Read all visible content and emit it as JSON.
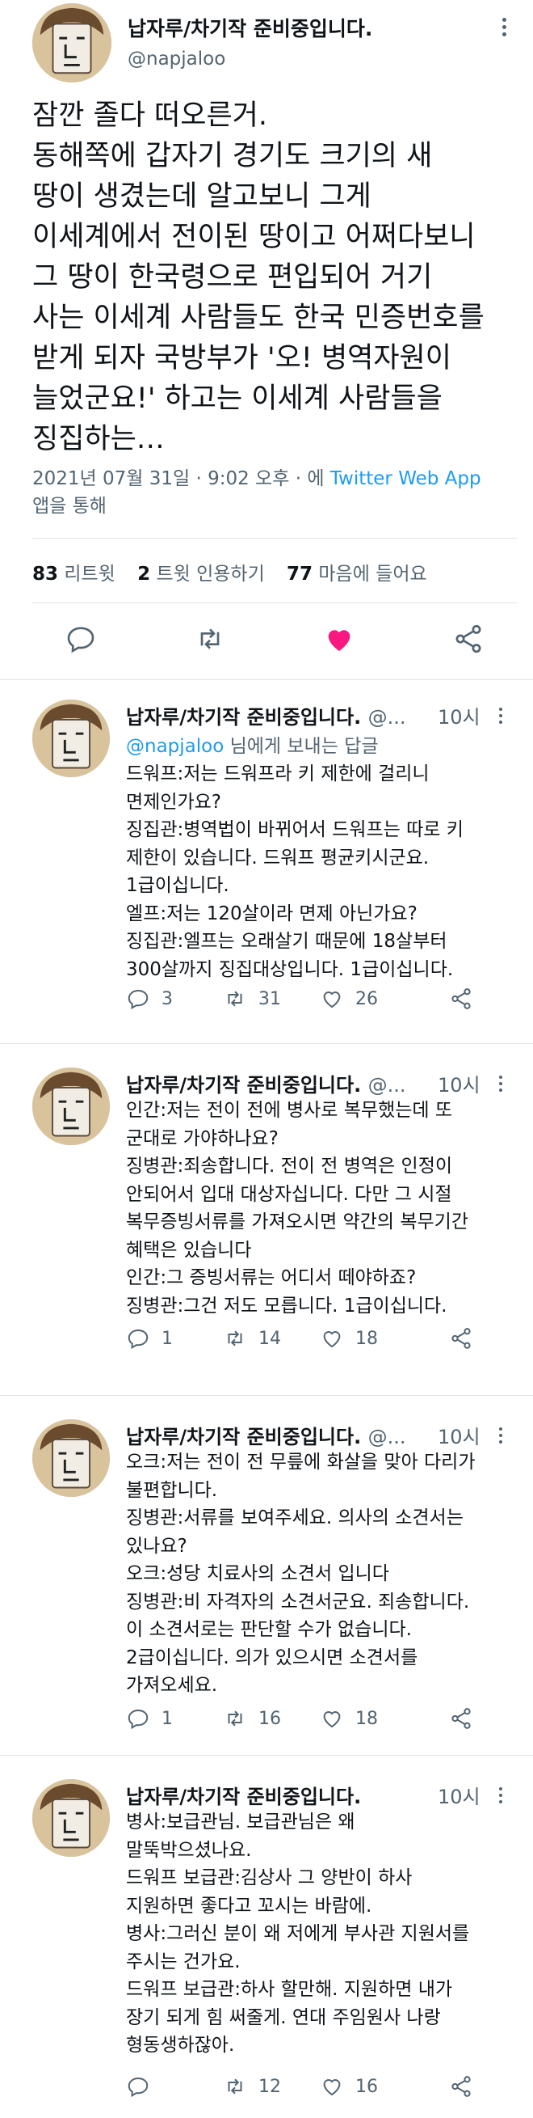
{
  "main_tweet": {
    "display_name": "납자루/차기작 준비중입니다.",
    "handle": "@napjaloo",
    "body_lines": [
      "잠깐 졸다 떠오른거.",
      "동해쪽에 갑자기 경기도 크기의 새",
      "땅이 생겼는데 알고보니 그게",
      "이세계에서 전이된 땅이고 어쩌다보니",
      "그 땅이 한국령으로 편입되어 거기",
      "사는 이세계 사람들도 한국 민증번호를",
      "받게 되자 국방부가 '오! 병역자원이",
      "늘었군요!' 하고는 이세계 사람들을",
      "징집하는…"
    ],
    "timestamp": "2021년 07월 31일 · 9:02 오후 · 에",
    "client": "Twitter Web App",
    "client_suffix": "앱을 통해",
    "stats": [
      {
        "count": "83",
        "label": "리트윗"
      },
      {
        "count": "2",
        "label": "트윗 인용하기"
      },
      {
        "count": "77",
        "label": "마음에 들어요"
      }
    ],
    "actions": {
      "reply": "reply-icon",
      "retweet": "retweet-icon",
      "like": "heart-icon-liked",
      "share": "share-icon"
    },
    "like_color": "#f91880"
  },
  "replies": [
    {
      "display_name": "납자루/차기작 준비중입니다.",
      "handle": "@...",
      "time": "10시",
      "reply_to_prefix": "@napjaloo",
      "reply_to_suffix": "님에게 보내는 답글",
      "body_lines": [
        "드워프:저는 드워프라 키 제한에 걸리니",
        "면제인가요?",
        "징집관:병역법이 바뀌어서 드워프는 따로 키",
        "제한이 있습니다. 드워프 평균키시군요.",
        "1급이십니다.",
        "엘프:저는 120살이라 면제 아닌가요?",
        "징집관:엘프는 오래살기 때문에 18살부터",
        "300살까지 징집대상입니다. 1급이십니다."
      ],
      "reply_count": "3",
      "retweet_count": "31",
      "like_count": "26"
    },
    {
      "display_name": "납자루/차기작 준비중입니다.",
      "handle": "@...",
      "time": "10시",
      "body_lines": [
        "인간:저는 전이 전에 병사로 복무했는데 또",
        "군대로 가야하나요?",
        "징병관:죄송합니다. 전이 전 병역은 인정이",
        "안되어서 입대 대상자십니다. 다만 그 시절",
        "복무증빙서류를 가져오시면 약간의 복무기간",
        "혜택은 있습니다",
        "인간:그 증빙서류는 어디서 떼야하죠?",
        "징병관:그건 저도 모릅니다. 1급이십니다."
      ],
      "reply_count": "1",
      "retweet_count": "14",
      "like_count": "18"
    },
    {
      "display_name": "납자루/차기작 준비중입니다.",
      "handle": "@...",
      "time": "10시",
      "body_lines": [
        "오크:저는 전이 전 무릎에 화살을 맞아 다리가",
        "불편합니다.",
        "징병관:서류를 보여주세요. 의사의 소견서는",
        "있나요?",
        "오크:성당 치료사의 소견서 입니다",
        "징병관:비 자격자의 소견서군요. 죄송합니다.",
        "이 소견서로는 판단할 수가 없습니다.",
        "2급이십니다. 의가 있으시면 소견서를",
        "가져오세요."
      ],
      "reply_count": "1",
      "retweet_count": "16",
      "like_count": "18"
    },
    {
      "display_name": "납자루/차기작 준비중입니다.",
      "handle": "@...",
      "time": "10시",
      "body_lines": [
        "병사:보급관님. 보급관님은 왜",
        "말뚝박으셨나요.",
        "드워프 보급관:김상사 그 양반이 하사",
        "지원하면 좋다고 꼬시는 바람에.",
        "병사:그러신 분이 왜 저에게 부사관 지원서를",
        "주시는 건가요.",
        "드워프 보급관:하사 할만해. 지원하면 내가",
        "장기 되게 힘 써줄게. 연대 주임원사 나랑",
        "형동생하잖아."
      ],
      "reply_count": "",
      "retweet_count": "12",
      "like_count": "16"
    }
  ]
}
